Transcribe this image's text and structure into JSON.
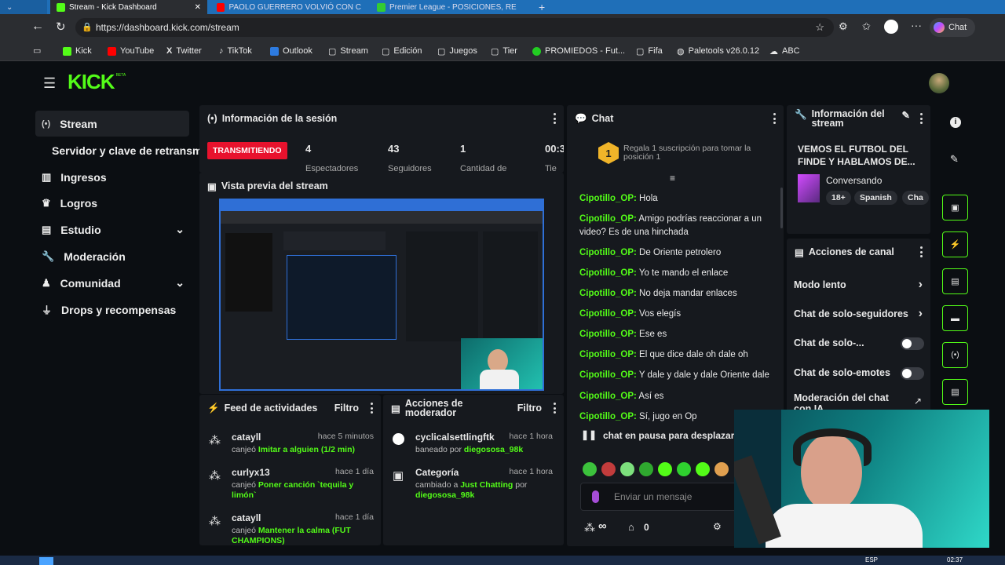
{
  "browser": {
    "tabs": [
      {
        "label": "Stream - Kick Dashboard"
      },
      {
        "label": "PAOLO GUERRERO VOLVIÓ CON C"
      },
      {
        "label": "Premier League - POSICIONES, RE"
      }
    ],
    "url": "https://dashboard.kick.com/stream",
    "chat_button": "Chat",
    "bookmarks": [
      "Kick",
      "YouTube",
      "Twitter",
      "TikTok",
      "Outlook",
      "Stream",
      "Edición",
      "Juegos",
      "Tier",
      "PROMIEDOS - Fut...",
      "Fifa",
      "Paletools v26.0.12",
      "ABC"
    ]
  },
  "app": {
    "logo": "KICK",
    "logo_beta": "BETA"
  },
  "sidebar": {
    "items": [
      {
        "label": "Stream"
      },
      {
        "label": "Servidor y clave de retransm"
      },
      {
        "label": "Ingresos"
      },
      {
        "label": "Logros"
      },
      {
        "label": "Estudio"
      },
      {
        "label": "Moderación"
      },
      {
        "label": "Comunidad"
      },
      {
        "label": "Drops y recompensas"
      }
    ]
  },
  "session": {
    "title": "Información de la sesión",
    "status": "TRANSMITIENDO",
    "stats": [
      {
        "value": "4",
        "label": "Espectadores"
      },
      {
        "value": "43",
        "label": "Seguidores"
      },
      {
        "value": "1",
        "label": "Cantidad de"
      },
      {
        "value": "00:3",
        "label": "Tie"
      }
    ]
  },
  "preview": {
    "title": "Vista previa del stream"
  },
  "feed": {
    "title": "Feed de actividades",
    "filter": "Filtro",
    "items": [
      {
        "user": "catayll",
        "time": "hace 5 minutos",
        "action": "canjeó",
        "reward": "Imitar a alguien (1/2 min)"
      },
      {
        "user": "curlyx13",
        "time": "hace 1 día",
        "action": "canjeó",
        "reward": "Poner canción `tequila y limón`"
      },
      {
        "user": "catayll",
        "time": "hace 1 día",
        "action": "canjeó",
        "reward": "Mantener la calma (FUT CHAMPIONS)"
      }
    ]
  },
  "modactions": {
    "title": "Acciones de moderador",
    "filter": "Filtro",
    "items": [
      {
        "title": "cyclicalsettlingftk",
        "time": "hace 1 hora",
        "desc": "baneado por",
        "by": "diegososa_98k"
      },
      {
        "title": "Categoría",
        "time": "hace 1 hora",
        "desc": "cambiado a",
        "target": "Just Chatting",
        "por": "por",
        "by": "diegososa_98k"
      }
    ]
  },
  "chat": {
    "title": "Chat",
    "gift_badge": "1",
    "gift_text": "Regala 1 suscripción para tomar la posición 1",
    "messages": [
      {
        "user": "Cipotillo_OP:",
        "text": "Hola"
      },
      {
        "user": "Cipotillo_OP:",
        "text": "Amigo podrías reaccionar a un video? Es de una hinchada"
      },
      {
        "user": "Cipotillo_OP:",
        "text": "De Oriente petrolero"
      },
      {
        "user": "Cipotillo_OP:",
        "text": "Yo te mando el enlace"
      },
      {
        "user": "Cipotillo_OP:",
        "text": "No deja mandar enlaces"
      },
      {
        "user": "Cipotillo_OP:",
        "text": "Vos elegís"
      },
      {
        "user": "Cipotillo_OP:",
        "text": "Ese es"
      },
      {
        "user": "Cipotillo_OP:",
        "text": "El que dice dale oh dale oh"
      },
      {
        "user": "Cipotillo_OP:",
        "text": "Y dale y dale y dale Oriente dale"
      },
      {
        "user": "Cipotillo_OP:",
        "text": "Así es"
      },
      {
        "user": "Cipotillo_OP:",
        "text": "Sí, jugo en Op"
      }
    ],
    "paused": "chat en pausa para desplazar",
    "input_placeholder": "Enviar un mensaje",
    "infinity": "∞",
    "points": "0"
  },
  "streaminfo": {
    "title": "Información del stream",
    "stream_title": "VEMOS EL FUTBOL DEL FINDE Y HABLAMOS DE...",
    "category": "Conversando",
    "tags": [
      "18+",
      "Spanish",
      "Cha"
    ]
  },
  "channel": {
    "title": "Acciones de canal",
    "items": [
      {
        "label": "Modo lento"
      },
      {
        "label": "Chat de solo-seguidores"
      },
      {
        "label": "Chat de solo-..."
      },
      {
        "label": "Chat de solo-emotes"
      },
      {
        "label": "Moderación del chat con IA"
      }
    ]
  },
  "taskbar": {
    "lang": "ESP",
    "time": "02:37"
  },
  "colors": {
    "accent": "#53fc18",
    "live": "#e8122d",
    "panel": "#16191e"
  }
}
